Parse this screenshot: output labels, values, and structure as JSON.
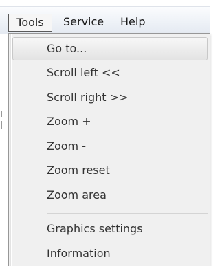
{
  "menubar": {
    "items": [
      {
        "label": "Tools",
        "open": true
      },
      {
        "label": "Service"
      },
      {
        "label": "Help"
      }
    ]
  },
  "tools_menu": {
    "items": [
      {
        "label": "Go to...",
        "highlighted": true
      },
      {
        "label": "Scroll left <<"
      },
      {
        "label": "Scroll right >>"
      },
      {
        "label": "Zoom +"
      },
      {
        "label": "Zoom -"
      },
      {
        "label": "Zoom reset"
      },
      {
        "label": "Zoom area"
      }
    ],
    "items_after_separator": [
      {
        "label": "Graphics settings"
      },
      {
        "label": "Information"
      }
    ]
  }
}
